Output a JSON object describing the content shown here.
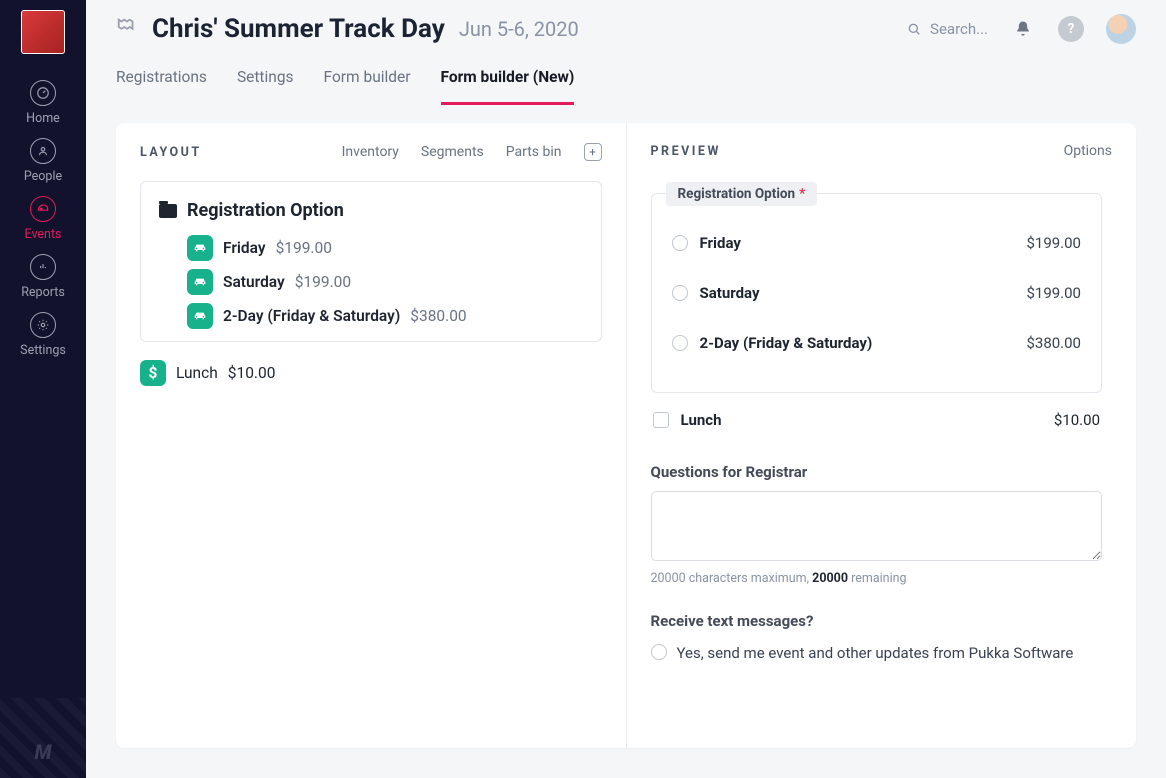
{
  "sidebar": {
    "items": [
      {
        "label": "Home"
      },
      {
        "label": "People"
      },
      {
        "label": "Events"
      },
      {
        "label": "Reports"
      },
      {
        "label": "Settings"
      }
    ],
    "footer_mark": "M"
  },
  "header": {
    "title": "Chris' Summer Track Day",
    "date": "Jun 5-6, 2020",
    "search_placeholder": "Search..."
  },
  "tabs": [
    {
      "label": "Registrations"
    },
    {
      "label": "Settings"
    },
    {
      "label": "Form builder"
    },
    {
      "label": "Form builder (New)"
    }
  ],
  "layout_pane": {
    "title": "LAYOUT",
    "links": {
      "inventory": "Inventory",
      "segments": "Segments",
      "parts_bin": "Parts bin"
    },
    "group_title": "Registration Option",
    "items": [
      {
        "name": "Friday",
        "price": "$199.00"
      },
      {
        "name": "Saturday",
        "price": "$199.00"
      },
      {
        "name": "2-Day (Friday & Saturday)",
        "price": "$380.00"
      }
    ],
    "lunch": {
      "name": "Lunch",
      "price": "$10.00"
    }
  },
  "preview_pane": {
    "title": "PREVIEW",
    "options_label": "Options",
    "legend": "Registration Option",
    "required_mark": "*",
    "options": [
      {
        "label": "Friday",
        "price": "$199.00"
      },
      {
        "label": "Saturday",
        "price": "$199.00"
      },
      {
        "label": "2-Day (Friday & Saturday)",
        "price": "$380.00"
      }
    ],
    "lunch": {
      "label": "Lunch",
      "price": "$10.00"
    },
    "questions_label": "Questions for Registrar",
    "hint_prefix": "20000 characters maximum, ",
    "hint_remaining": "20000",
    "hint_suffix": " remaining",
    "sms_label": "Receive text messages?",
    "sms_option": "Yes, send me event and other updates from Pukka Software"
  }
}
